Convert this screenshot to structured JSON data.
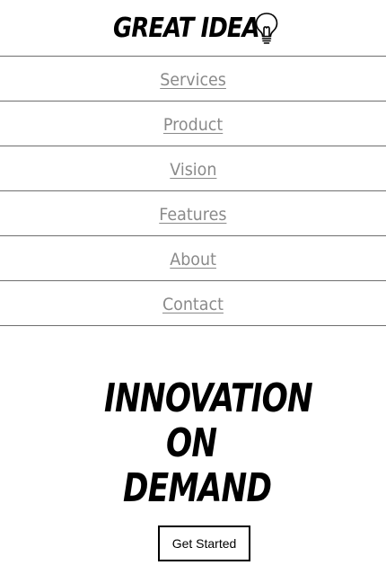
{
  "brand": {
    "name": "GREAT IDEA",
    "logo_icon": "lightbulb-icon"
  },
  "nav": {
    "items": [
      {
        "label": "Services"
      },
      {
        "label": "Product"
      },
      {
        "label": "Vision"
      },
      {
        "label": "Features"
      },
      {
        "label": "About"
      },
      {
        "label": "Contact"
      }
    ]
  },
  "hero": {
    "line1": "INNOVATION",
    "line2": "ON",
    "line3": "DEMAND",
    "cta_label": "Get Started"
  },
  "colors": {
    "text": "#000000",
    "nav_link": "#8a8a8a",
    "divider": "#6e6e6e",
    "background": "#ffffff"
  }
}
